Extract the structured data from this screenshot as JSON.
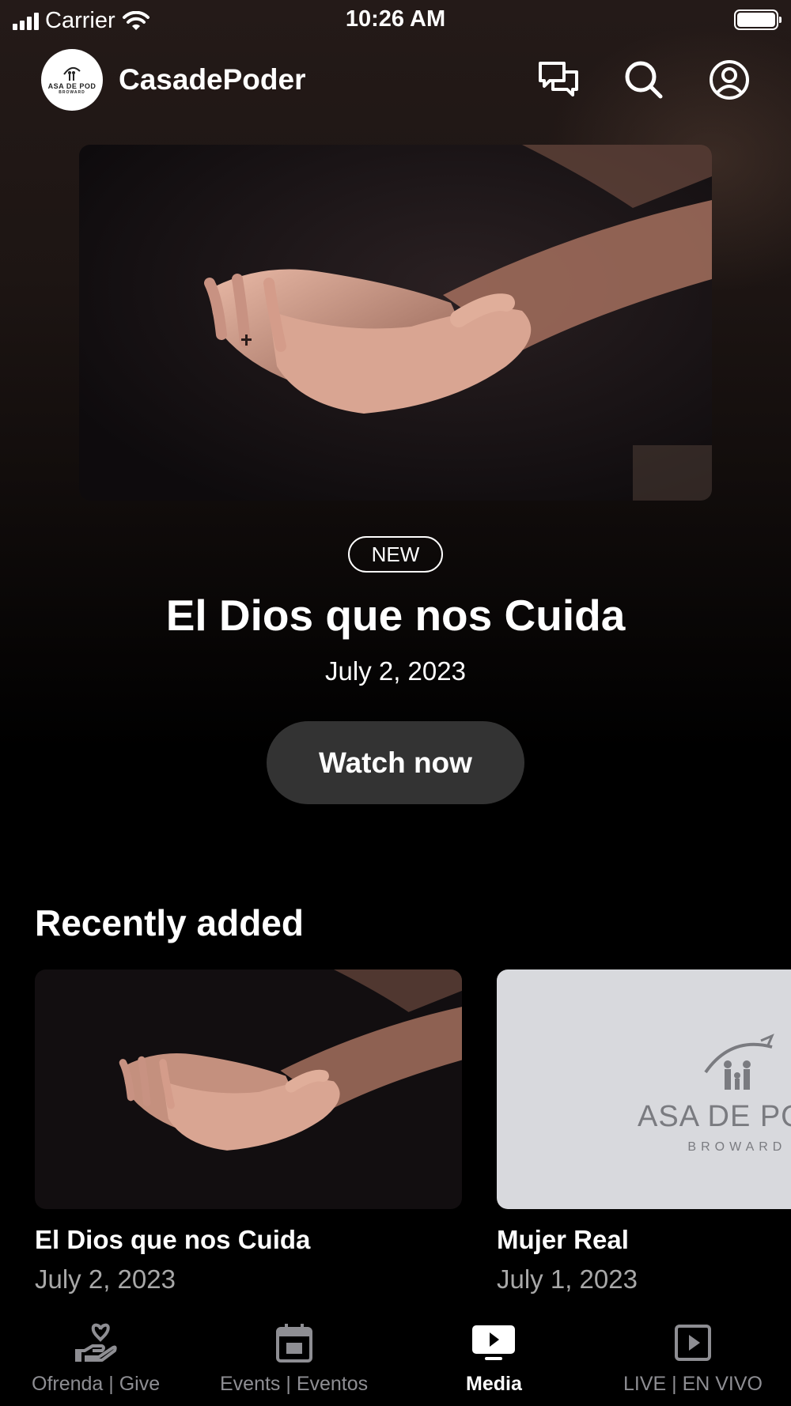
{
  "status_bar": {
    "carrier": "Carrier",
    "time": "10:26 AM"
  },
  "header": {
    "logo_text": "ASA DE POD",
    "logo_sub": "BROWARD",
    "app_name": "CasadePoder",
    "icons": [
      "chat-icon",
      "search-icon",
      "profile-icon"
    ]
  },
  "hero": {
    "badge": "NEW",
    "title": "El Dios que nos Cuida",
    "date": "July 2, 2023",
    "cta": "Watch now"
  },
  "recently_added": {
    "title": "Recently added",
    "items": [
      {
        "title": "El Dios que nos Cuida",
        "date": "July 2, 2023"
      },
      {
        "title": "Mujer Real",
        "date": "July 1, 2023",
        "watermark": "ASA DE PODI",
        "watermark_sub": "BROWARD"
      }
    ]
  },
  "tabs": [
    {
      "label": "Ofrenda | Give",
      "icon": "hand-heart-icon",
      "active": false
    },
    {
      "label": "Events | Eventos",
      "icon": "calendar-icon",
      "active": false
    },
    {
      "label": "Media",
      "icon": "tv-play-icon",
      "active": true
    },
    {
      "label": "LIVE | EN VIVO",
      "icon": "play-square-icon",
      "active": false
    }
  ],
  "colors": {
    "background": "#000000",
    "button": "#333333",
    "tab_inactive": "#8e8e93",
    "tab_active": "#ffffff"
  }
}
